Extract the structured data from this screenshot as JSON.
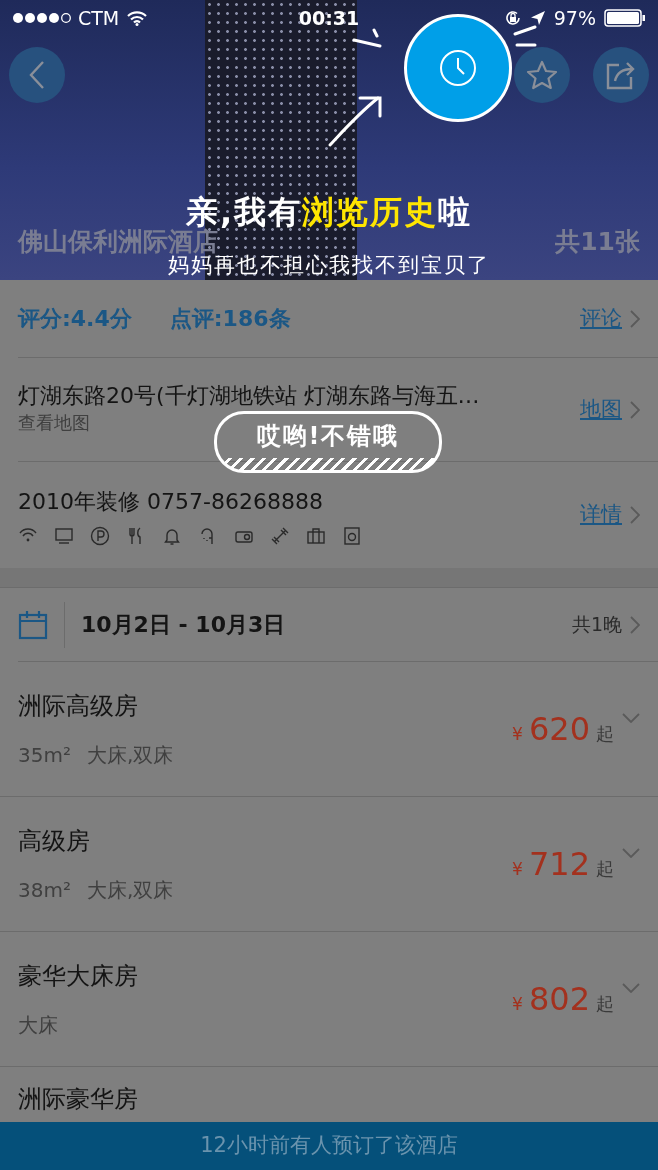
{
  "status_bar": {
    "carrier": "CTM",
    "time": "00:31",
    "battery": "97%"
  },
  "header": {
    "hotel_name": "佛山保利洲际酒店",
    "photo_count": "共11张"
  },
  "tutorial": {
    "headline": [
      {
        "text": "亲,我有",
        "highlight": false
      },
      {
        "text": "浏览历史",
        "highlight": true
      },
      {
        "text": "啦",
        "highlight": false
      }
    ],
    "subtitle": "妈妈再也不担心我找不到宝贝了",
    "bubble": "哎哟!不错哦"
  },
  "rating": {
    "score": "评分:4.4分",
    "reviews": "点评:186条",
    "link": "评论"
  },
  "address": {
    "text": "灯湖东路20号(千灯湖地铁站 灯湖东路与海五…",
    "sub": "查看地图",
    "link": "地图"
  },
  "info": {
    "text": "2010年装修 0757-86268888",
    "link": "详情"
  },
  "dates": {
    "range": "10月2日 - 10月3日",
    "nights": "共1晚"
  },
  "rooms": [
    {
      "name": "洲际高级房",
      "area": "35m²",
      "beds": "大床,双床",
      "currency": "¥",
      "price": "620",
      "suffix": "起"
    },
    {
      "name": "高级房",
      "area": "38m²",
      "beds": "大床,双床",
      "currency": "¥",
      "price": "712",
      "suffix": "起"
    },
    {
      "name": "豪华大床房",
      "beds": "大床",
      "currency": "¥",
      "price": "802",
      "suffix": "起"
    },
    {
      "name": "洲际豪华房"
    }
  ],
  "banner": "12小时前有人预订了该酒店"
}
